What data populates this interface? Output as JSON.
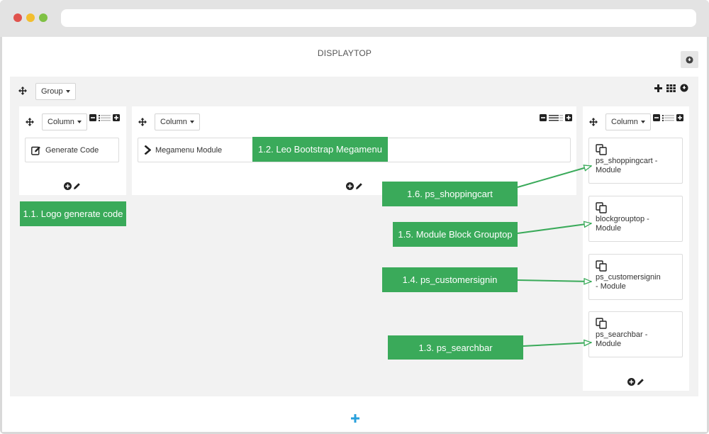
{
  "hook_title": "DISPLAYTOP",
  "group": {
    "dropdown_label": "Group",
    "toolbar_icons": [
      "plus-icon",
      "grid-icon",
      "circle-down-icon"
    ]
  },
  "columns": [
    {
      "dropdown_label": "Column",
      "widgets": [
        {
          "label": "Generate Code",
          "icon": "edit-icon"
        }
      ]
    },
    {
      "dropdown_label": "Column",
      "widgets": [
        {
          "label": "Megamenu Module",
          "icon": "chevron-right-icon"
        }
      ]
    },
    {
      "dropdown_label": "Column",
      "modules": [
        {
          "name": "ps_shoppingcart -",
          "sub": "Module"
        },
        {
          "name": "blockgrouptop -",
          "sub": "Module"
        },
        {
          "name": "ps_customersignin",
          "sub": "- Module"
        },
        {
          "name": "ps_searchbar -",
          "sub": "Module"
        }
      ]
    }
  ],
  "callouts": {
    "logo": "1.1. Logo generate code",
    "megamenu": "1.2. Leo Bootstrap Megamenu",
    "shoppingcart": "1.6. ps_shoppingcart",
    "grouptop": "1.5. Module Block Grouptop",
    "customersignin": "1.4. ps_customersignin",
    "searchbar": "1.3. ps_searchbar"
  },
  "colors": {
    "callout_green": "#3aaa5a",
    "add_blue": "#29a0dc"
  }
}
